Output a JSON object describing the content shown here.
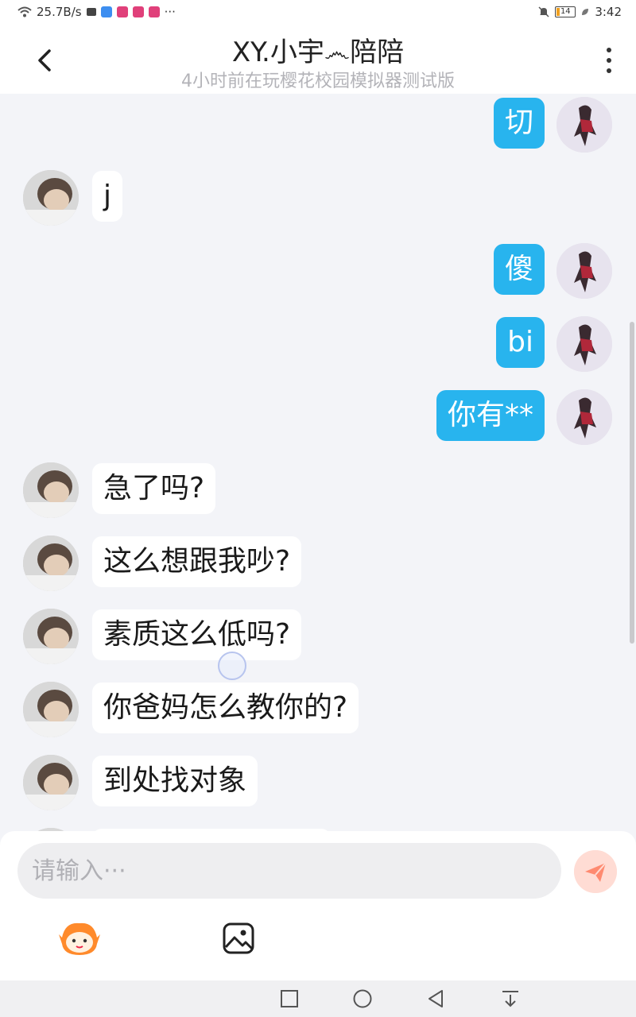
{
  "status_bar": {
    "network_speed": "25.7B/s",
    "battery": "14",
    "time": "3:42"
  },
  "header": {
    "title": "XY.小宇෴陪陪",
    "subtitle": "4小时前在玩樱花校园模拟器测试版"
  },
  "messages": [
    {
      "sender": "me",
      "text": "切"
    },
    {
      "sender": "other",
      "text": "j"
    },
    {
      "sender": "me",
      "text": "傻"
    },
    {
      "sender": "me",
      "text": "bi"
    },
    {
      "sender": "me",
      "text": "你有**"
    },
    {
      "sender": "other",
      "text": "急了吗?"
    },
    {
      "sender": "other",
      "text": "这么想跟我吵?"
    },
    {
      "sender": "other",
      "text": "素质这么低吗?"
    },
    {
      "sender": "other",
      "text": "你爸妈怎么教你的?"
    },
    {
      "sender": "other",
      "text": "到处找对象"
    }
  ],
  "input": {
    "placeholder": "请输入···",
    "value": ""
  },
  "colors": {
    "my_bubble": "#28b4ee",
    "other_bubble": "#ffffff",
    "send_button": "#ff6a4d"
  },
  "icons": [
    "wifi-icon",
    "back-icon",
    "more-icon",
    "send-icon",
    "emoji-icon",
    "image-icon",
    "nav-square-icon",
    "nav-home-icon",
    "nav-back-icon",
    "nav-down-icon"
  ]
}
